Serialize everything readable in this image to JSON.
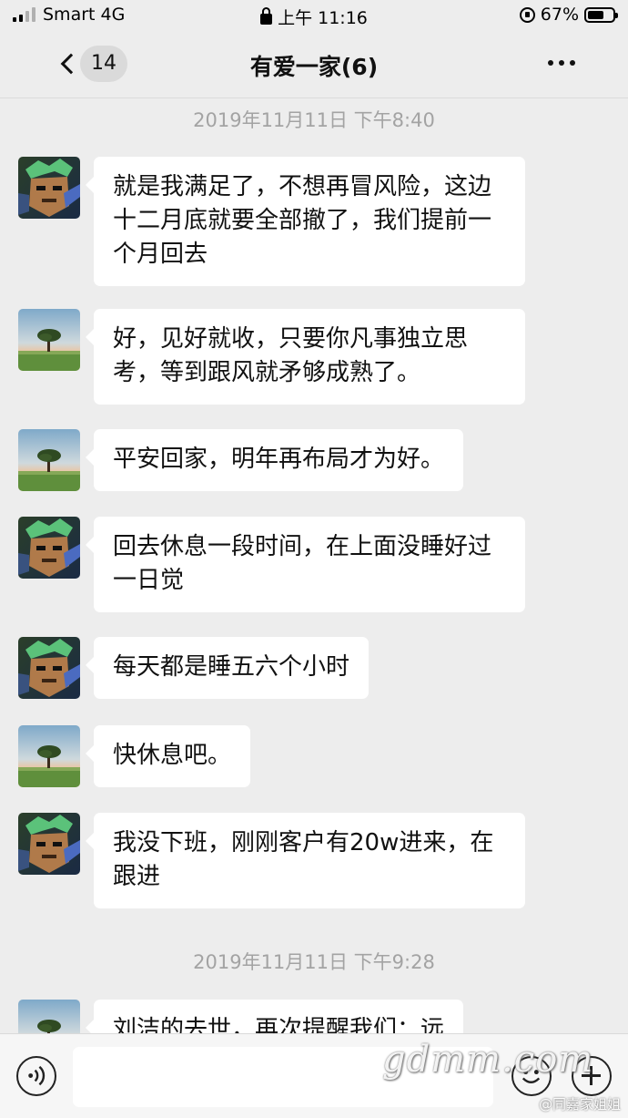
{
  "status_bar": {
    "carrier": "Smart 4G",
    "time": "上午 11:16",
    "battery": "67%",
    "battery_level": 0.67
  },
  "nav": {
    "unread_count": "14",
    "title": "有爱一家(6)"
  },
  "messages": [
    {
      "type": "timestamp",
      "text": "2019年11月11日 下午8:40"
    },
    {
      "type": "message",
      "avatar": "cartoon-avatar",
      "text": "就是我满足了，不想再冒风险，这边十二月底就要全部撤了，我们提前一个月回去"
    },
    {
      "type": "message",
      "avatar": "tree-avatar",
      "text": "好，见好就收，只要你凡事独立思考，等到跟风就矛够成熟了。"
    },
    {
      "type": "message",
      "avatar": "tree-avatar",
      "text": "平安回家，明年再布局才为好。"
    },
    {
      "type": "message",
      "avatar": "cartoon-avatar",
      "text": "回去休息一段时间，在上面没睡好过一日觉"
    },
    {
      "type": "message",
      "avatar": "cartoon-avatar",
      "text": "每天都是睡五六个小时"
    },
    {
      "type": "message",
      "avatar": "tree-avatar",
      "text": "快休息吧。"
    },
    {
      "type": "message",
      "avatar": "cartoon-avatar",
      "text": "我没下班，刚刚客户有20w进来，在跟进"
    },
    {
      "type": "timestamp",
      "text": "2019年11月11日 下午9:28"
    },
    {
      "type": "message",
      "avatar": "tree-avatar",
      "text": "刘洁的去世，再次提醒我们：远"
    }
  ],
  "watermark": {
    "text": "gdmm.com",
    "sub": "@同嘉家姐姐"
  }
}
